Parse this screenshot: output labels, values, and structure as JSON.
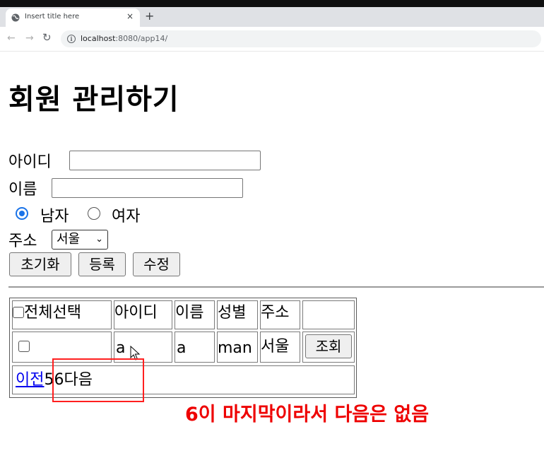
{
  "browser": {
    "tab_title": "Insert title here",
    "close_glyph": "×",
    "new_tab_glyph": "+",
    "url_host": "localhost",
    "url_rest": ":8080/app14/"
  },
  "page": {
    "heading": "회원 관리하기",
    "id_label": "아이디",
    "id_value": "",
    "name_label": "이름",
    "name_value": "",
    "gender": {
      "male_label": "남자",
      "female_label": "여자",
      "selected": "남자"
    },
    "address_label": "주소",
    "address_selected": "서울",
    "buttons": {
      "reset": "초기화",
      "register": "등록",
      "update": "수정"
    }
  },
  "table": {
    "headers": {
      "select_all": "전체선택",
      "id": "아이디",
      "name": "이름",
      "gender": "성별",
      "address": "주소"
    },
    "rows": [
      {
        "id": "a",
        "name": "a",
        "gender": "man",
        "address": "서울",
        "action": "조회"
      }
    ],
    "pager": {
      "prev": "이전",
      "page5": "5",
      "page6": "6",
      "next": "다음"
    }
  },
  "annotation": {
    "text": "6이 마지막이라서 다음은 없음",
    "color": "#ee0000"
  }
}
